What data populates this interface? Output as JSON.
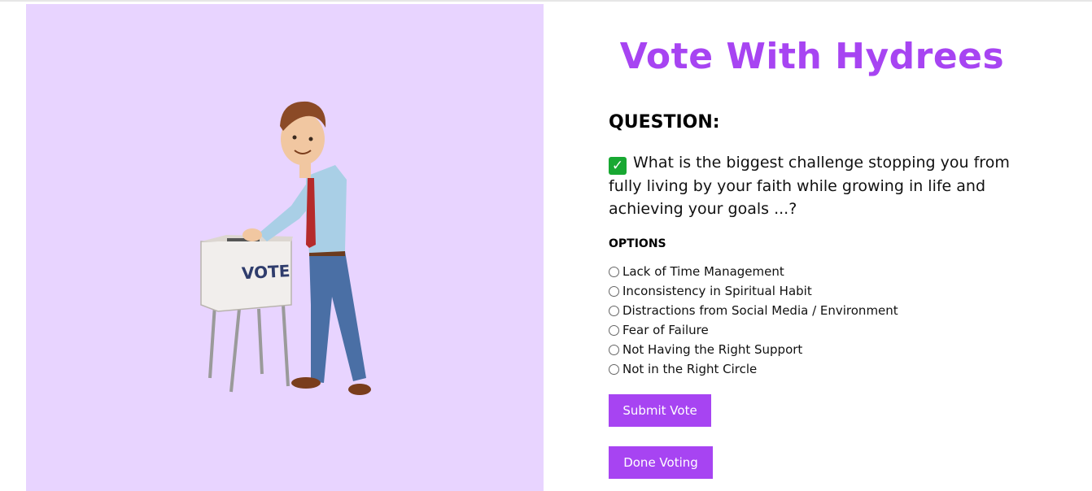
{
  "header": {
    "title": "Vote With Hydrees"
  },
  "question": {
    "heading": "QUESTION:",
    "check_icon": "check-mark-icon",
    "text": "What is the biggest challenge stopping you from fully living by your faith while growing in life and achieving your goals ...?"
  },
  "options": {
    "heading": "OPTIONS",
    "items": [
      "Lack of Time Management",
      "Inconsistency in Spiritual Habit",
      "Distractions from Social Media / Environment",
      "Fear of Failure",
      "Not Having the Right Support",
      "Not in the Right Circle"
    ]
  },
  "buttons": {
    "submit": "Submit Vote",
    "done": "Done Voting"
  },
  "illustration": {
    "box_label": "VOTE"
  },
  "colors": {
    "accent": "#a744f2",
    "hero_bg": "#e8d4ff",
    "check": "#18a832"
  }
}
